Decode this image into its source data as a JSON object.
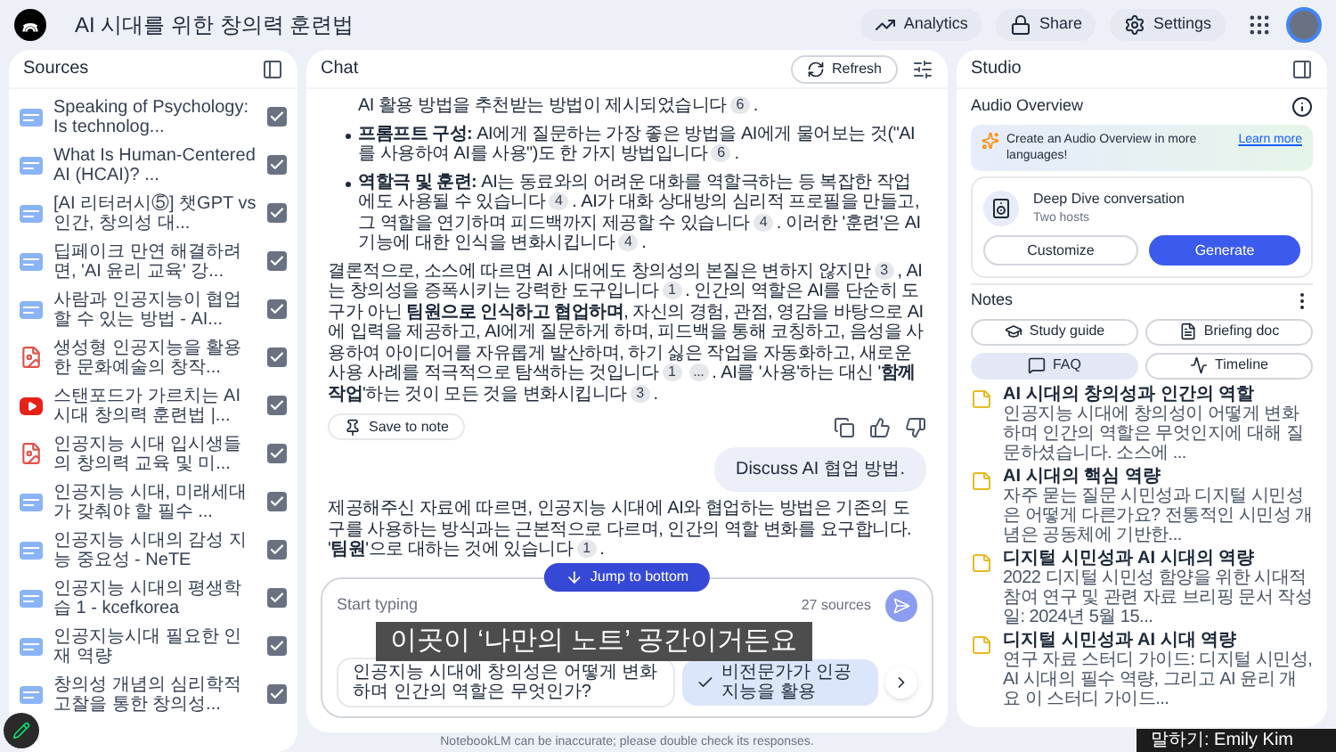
{
  "app": {
    "title": "AI 시대를 위한 창의력 훈련법",
    "actions": [
      "Analytics",
      "Share",
      "Settings"
    ]
  },
  "sources": {
    "title": "Sources",
    "items": [
      {
        "kind": "web",
        "title": "Speaking of Psychology: Is technolog...",
        "checked": true
      },
      {
        "kind": "web",
        "title": "What Is Human-Centered AI (HCAI)? ...",
        "checked": true
      },
      {
        "kind": "web",
        "title": "[AI 리터러시⑤] 챗GPT vs 인간, 창의성 대...",
        "checked": true
      },
      {
        "kind": "web",
        "title": "딥페이크 만연 해결하려면, 'AI 윤리 교육' 강...",
        "checked": true
      },
      {
        "kind": "web",
        "title": "사람과 인공지능이 협업할 수 있는 방법 - AI...",
        "checked": true
      },
      {
        "kind": "pdf",
        "title": "생성형 인공지능을 활용한 문화예술의 창작...",
        "checked": true
      },
      {
        "kind": "video",
        "title": "스탠포드가 가르치는 AI시대 창의력 훈련법 |...",
        "checked": true
      },
      {
        "kind": "pdf",
        "title": "인공지능 시대 입시생들의 창의력 교육 및 미...",
        "checked": true
      },
      {
        "kind": "web",
        "title": "인공지능 시대, 미래세대가 갖춰야 할 필수 ...",
        "checked": true
      },
      {
        "kind": "web",
        "title": "인공지능 시대의 감성 지능 중요성 - NeTE",
        "checked": true
      },
      {
        "kind": "web",
        "title": "인공지능 시대의 평생학습 1 - kcefkorea",
        "checked": true
      },
      {
        "kind": "web",
        "title": "인공지능시대 필요한 인재 역량",
        "checked": true
      },
      {
        "kind": "web",
        "title": "창의성 개념의 심리학적 고찰을 통한 창의성...",
        "checked": true
      }
    ]
  },
  "chat": {
    "title": "Chat",
    "refresh": "Refresh",
    "blocks": [
      {
        "kind": "continuation",
        "parts": [
          {
            "kind": "text",
            "text": "AI 활용 방법을 추천받는 방법이 제시되었습니다"
          },
          {
            "kind": "cite",
            "text": "6"
          },
          {
            "kind": "text",
            "text": "."
          }
        ]
      },
      {
        "kind": "bullet",
        "parts": [
          {
            "kind": "text",
            "text": "**프롬프트 구성:** AI에게 질문하는 가장 좋은 방법을 AI에게 물어보는 것(\"AI를 사용하여 AI를 사용\")도 한 가지 방법입니다"
          },
          {
            "kind": "cite",
            "text": "6"
          },
          {
            "kind": "text",
            "text": "."
          }
        ]
      },
      {
        "kind": "bullet",
        "parts": [
          {
            "kind": "text",
            "text": "**역할극 및 훈련:** AI는 동료와의 어려운 대화를 역할극하는 등 복잡한 작업에도 사용될 수 있습니다"
          },
          {
            "kind": "cite",
            "text": "4"
          },
          {
            "kind": "text",
            "text": ". AI가 대화 상대방의 심리적 프로필을 만들고, 그 역할을 연기하며 피드백까지 제공할 수 있습니다"
          },
          {
            "kind": "cite",
            "text": "4"
          },
          {
            "kind": "text",
            "text": ". 이러한 '훈련'은 AI 기능에 대한 인식을 변화시킵니다"
          },
          {
            "kind": "cite",
            "text": "4"
          },
          {
            "kind": "text",
            "text": "."
          }
        ]
      },
      {
        "kind": "paragraph",
        "parts": [
          {
            "kind": "text",
            "text": "결론적으로, 소스에 따르면 AI 시대에도 창의성의 본질은 변하지 않지만"
          },
          {
            "kind": "cite",
            "text": "3"
          },
          {
            "kind": "text",
            "text": ", AI는 창의성을 증폭시키는 강력한 도구입니다"
          },
          {
            "kind": "cite",
            "text": "1"
          },
          {
            "kind": "text",
            "text": ". 인간의 역할은 AI를 단순히 도구가 아닌 **팀원으로 인식하고 협업하며**, 자신의 경험, 관점, 영감을 바탕으로 AI에 입력을 제공하고, AI에게 질문하게 하며, 피드백을 통해 코칭하고, 음성을 사용하여 아이디어를 자유롭게 발산하며, 하기 싫은 작업을 자동화하고, 새로운 사용 사례를 적극적으로 탐색하는 것입니다"
          },
          {
            "kind": "cite",
            "text": "1"
          },
          {
            "kind": "cite",
            "text": "..."
          },
          {
            "kind": "text",
            "text": ". AI를 '사용'하는 대신 '**함께 작업**'하는 것이 모든 것을 변화시킵니다"
          },
          {
            "kind": "cite",
            "text": "3"
          },
          {
            "kind": "text",
            "text": "."
          }
        ]
      }
    ],
    "save_note": "Save to note",
    "user_message": "Discuss AI 협업 방법.",
    "response": [
      {
        "kind": "text",
        "text": "제공해주신 자료에 따르면, 인공지능 시대에 AI와 협업하는 방법은 기존의 도구를 사용하는 방식과는 근본적으로 다르며, 인간의 역할 변화를 요구합니다. '**팀원**'으로 대하는 것에 있습니다"
      },
      {
        "kind": "cite",
        "text": "1"
      },
      {
        "kind": "text",
        "text": "."
      }
    ],
    "jump": "Jump to bottom",
    "input": {
      "placeholder": "Start typing",
      "count": "27 sources",
      "suggestions": [
        "인공지능 시대에 창의성은 어떻게 변화하며 인간의 역할은 무엇인가?",
        "비전문가가 인공지능을 활용"
      ]
    },
    "disclaimer": "NotebookLM can be inaccurate; please double check its responses."
  },
  "studio": {
    "title": "Studio",
    "audio_title": "Audio Overview",
    "banner": "Create an Audio Overview in more languages!",
    "banner_link": "Learn more",
    "card_title": "Deep Dive conversation",
    "card_subtitle": "Two hosts",
    "customize": "Customize",
    "generate": "Generate",
    "notes_title": "Notes",
    "chips": [
      {
        "label": "Study guide",
        "selected": false
      },
      {
        "label": "Briefing doc",
        "selected": false
      },
      {
        "label": "FAQ",
        "selected": true
      },
      {
        "label": "Timeline",
        "selected": false
      }
    ],
    "notes": [
      {
        "title": "AI 시대의 창의성과 인간의 역할",
        "preview": "인공지능 시대에 창의성이 어떻게 변화하며 인간의 역할은 무엇인지에 대해 질문하셨습니다. 소스에 ..."
      },
      {
        "title": "AI 시대의 핵심 역량",
        "preview": "자주 묻는 질문 시민성과 디지털 시민성은 어떻게 다른가요? 전통적인 시민성 개념은 공동체에 기반한..."
      },
      {
        "title": "디지털 시민성과 AI 시대의 역량",
        "preview": "2022 디지털 시민성 함양을 위한 시대적 참여 연구 및 관련 자료 브리핑 문서 작성일: 2024년 5월 15..."
      },
      {
        "title": "디지털 시민성과 AI 시대 역량",
        "preview": "연구 자료 스터디 가이드: 디지털 시민성, AI 시대의 필수 역량, 그리고 AI 윤리 개요 이 스터디 가이드..."
      }
    ]
  },
  "caption": "이곳이 ‘나만의 노트’ 공간이거든요",
  "speaker": "말하기: Emily Kim"
}
